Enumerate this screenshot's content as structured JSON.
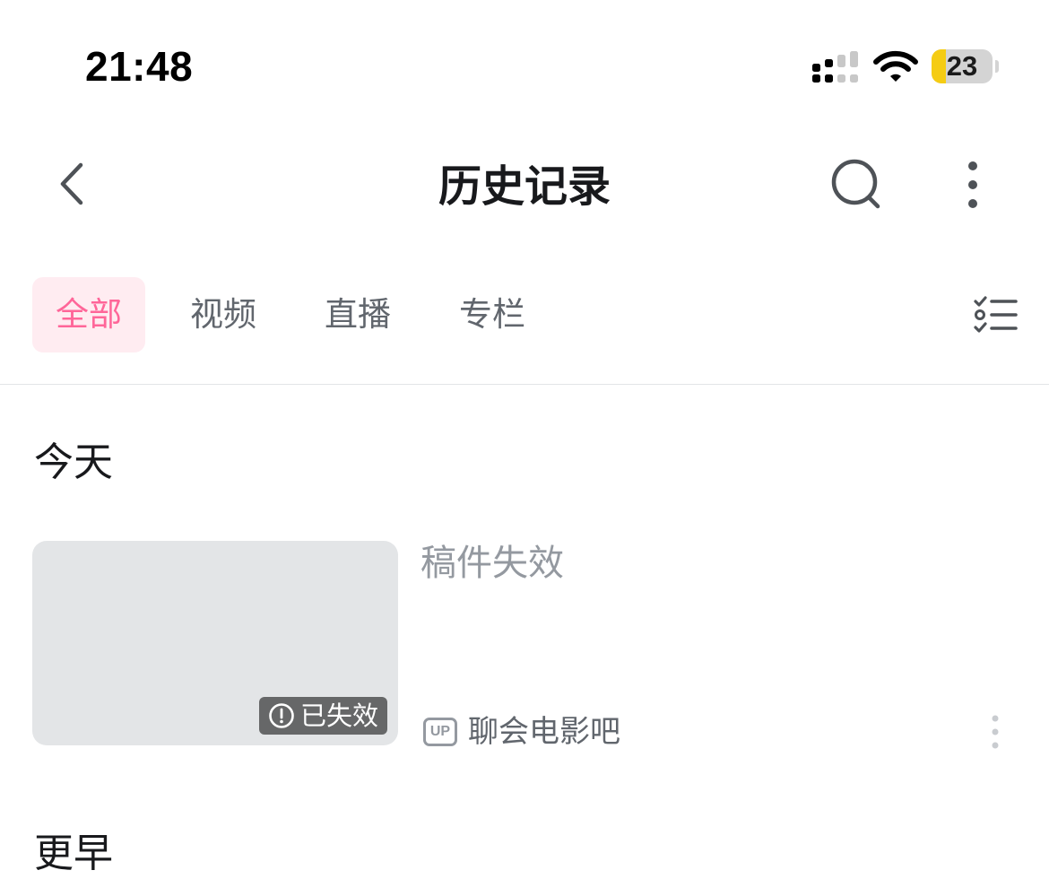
{
  "status_bar": {
    "time": "21:48",
    "battery_level": "23",
    "battery_fraction": 0.23,
    "icons": [
      "signal-icon",
      "wifi-icon",
      "battery-icon"
    ]
  },
  "nav": {
    "title": "历史记录",
    "icons": [
      "back-arrow-icon",
      "search-icon",
      "more-vertical-icon"
    ]
  },
  "tabs": [
    {
      "label": "全部",
      "active": true
    },
    {
      "label": "视频",
      "active": false
    },
    {
      "label": "直播",
      "active": false
    },
    {
      "label": "专栏",
      "active": false
    }
  ],
  "tab_bar_icon": "checklist-icon",
  "sections": [
    {
      "header": "今天",
      "items": [
        {
          "title": "稿件失效",
          "badge": "已失效",
          "badge_icon": "exclamation-circle-icon",
          "uploader_icon": "UP",
          "uploader": "聊会电影吧",
          "more_icon": "more-vertical-icon"
        }
      ]
    },
    {
      "header": "更早"
    }
  ],
  "colors": {
    "accent": "#ff6699",
    "accent_bg": "#ffecf1",
    "text_primary": "#18191c",
    "text_secondary": "#61666d",
    "text_tertiary": "#9499a0",
    "thumbnail_bg": "#e3e5e7",
    "battery_fill": "#f5cc13"
  }
}
